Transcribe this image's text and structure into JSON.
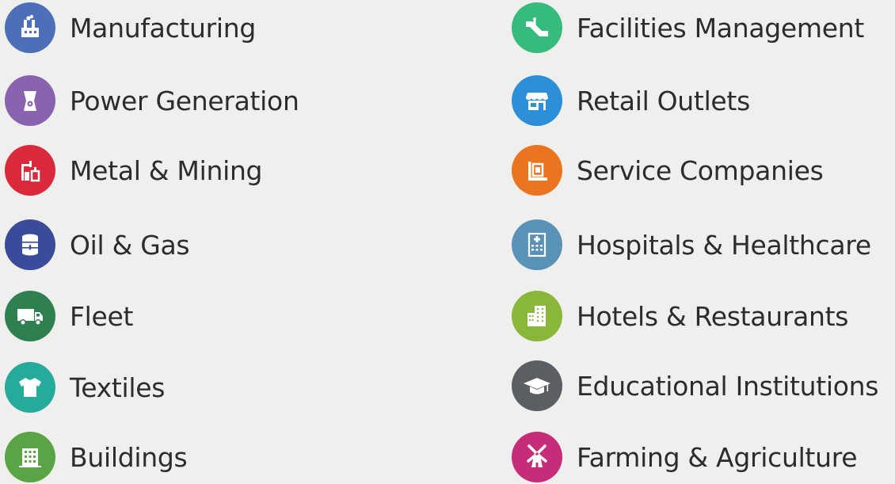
{
  "left_items": [
    {
      "label": "Manufacturing",
      "icon": "factory-icon",
      "color": "#4d6fb8"
    },
    {
      "label": "Power Generation",
      "icon": "cooling-tower-icon",
      "color": "#8a63b0"
    },
    {
      "label": "Metal & Mining",
      "icon": "mining-icon",
      "color": "#d9293a"
    },
    {
      "label": "Oil & Gas",
      "icon": "oil-barrel-icon",
      "color": "#3a4b9a"
    },
    {
      "label": "Fleet",
      "icon": "truck-icon",
      "color": "#2f8050"
    },
    {
      "label": "Textiles",
      "icon": "tshirt-icon",
      "color": "#26aa9c"
    },
    {
      "label": "Buildings",
      "icon": "building-icon",
      "color": "#5aa445"
    }
  ],
  "right_items": [
    {
      "label": "Facilities Management",
      "icon": "escalator-icon",
      "color": "#36bb7d"
    },
    {
      "label": "Retail Outlets",
      "icon": "storefront-icon",
      "color": "#2e8fd9"
    },
    {
      "label": "Service Companies",
      "icon": "service-machine-icon",
      "color": "#ea7420"
    },
    {
      "label": "Hospitals & Healthcare",
      "icon": "hospital-icon",
      "color": "#5a91b6"
    },
    {
      "label": "Hotels & Restaurants",
      "icon": "hotel-icon",
      "color": "#8ab639"
    },
    {
      "label": "Educational Institutions",
      "icon": "graduation-cap-icon",
      "color": "#5b5f63"
    },
    {
      "label": "Farming & Agriculture",
      "icon": "windmill-icon",
      "color": "#c72c79"
    }
  ]
}
